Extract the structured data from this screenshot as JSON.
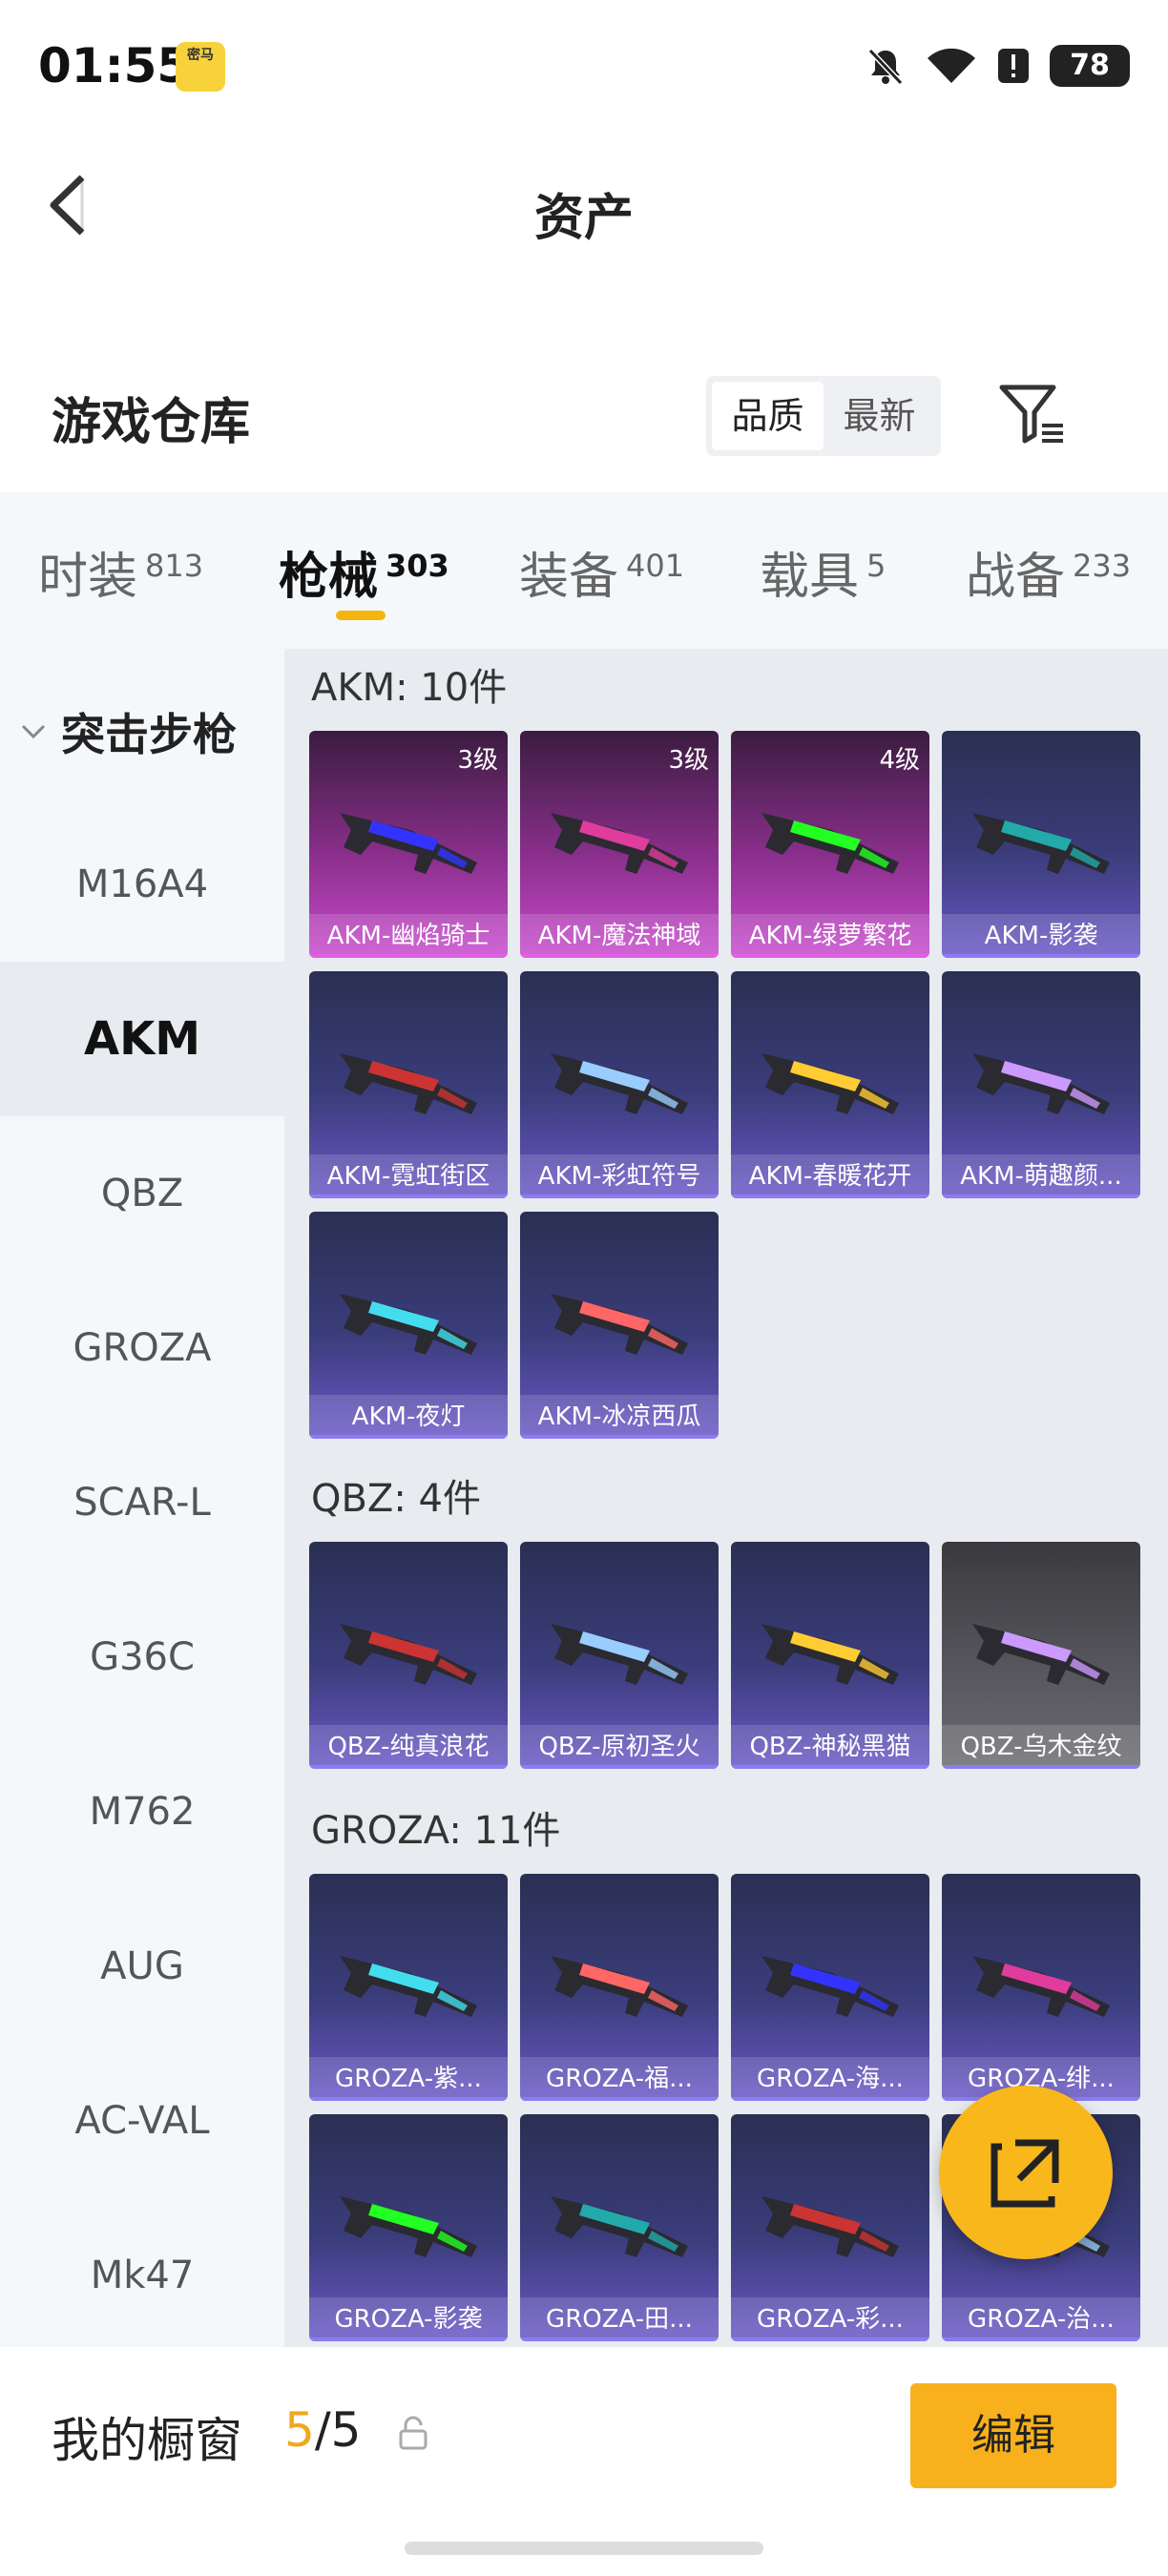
{
  "status": {
    "time": "01:55",
    "app_badge": "密马",
    "battery": "78"
  },
  "header": {
    "title": "资产"
  },
  "section": {
    "title": "游戏仓库"
  },
  "sort": {
    "quality": "品质",
    "newest": "最新"
  },
  "tabs": [
    {
      "label": "时装",
      "count": "813"
    },
    {
      "label": "枪械",
      "count": "303"
    },
    {
      "label": "装备",
      "count": "401"
    },
    {
      "label": "载具",
      "count": "5"
    },
    {
      "label": "战备",
      "count": "233"
    }
  ],
  "sidebar": {
    "category": "突击步枪",
    "items": [
      "M16A4",
      "AKM",
      "QBZ",
      "GROZA",
      "SCAR-L",
      "G36C",
      "M762",
      "AUG",
      "AC-VAL",
      "Mk47"
    ]
  },
  "groups": [
    {
      "title": "AKM: 10件",
      "items": [
        {
          "name": "AKM-幽焰骑士",
          "level": "3级"
        },
        {
          "name": "AKM-魔法神域",
          "level": "3级"
        },
        {
          "name": "AKM-绿萝繁花",
          "level": "4级"
        },
        {
          "name": "AKM-影袭"
        },
        {
          "name": "AKM-霓虹街区"
        },
        {
          "name": "AKM-彩虹符号"
        },
        {
          "name": "AKM-春暖花开"
        },
        {
          "name": "AKM-萌趣颜..."
        },
        {
          "name": "AKM-夜灯"
        },
        {
          "name": "AKM-冰凉西瓜"
        }
      ]
    },
    {
      "title": "QBZ: 4件",
      "items": [
        {
          "name": "QBZ-纯真浪花"
        },
        {
          "name": "QBZ-原初圣火"
        },
        {
          "name": "QBZ-神秘黑猫"
        },
        {
          "name": "QBZ-乌木金纹"
        }
      ]
    },
    {
      "title": "GROZA: 11件",
      "items": [
        {
          "name": "GROZA-紫..."
        },
        {
          "name": "GROZA-福..."
        },
        {
          "name": "GROZA-海..."
        },
        {
          "name": "GROZA-绯..."
        },
        {
          "name": "GROZA-影袭"
        },
        {
          "name": "GROZA-田..."
        },
        {
          "name": "GROZA-彩..."
        },
        {
          "name": "GROZA-治..."
        }
      ]
    }
  ],
  "bottom": {
    "label": "我的橱窗",
    "current": "5",
    "separator": "/",
    "total": "5",
    "edit": "编辑"
  },
  "colors": {
    "accent": "#f8b01c",
    "rare_purple": "#c94bcf",
    "common_blue": "#6b58c8"
  }
}
